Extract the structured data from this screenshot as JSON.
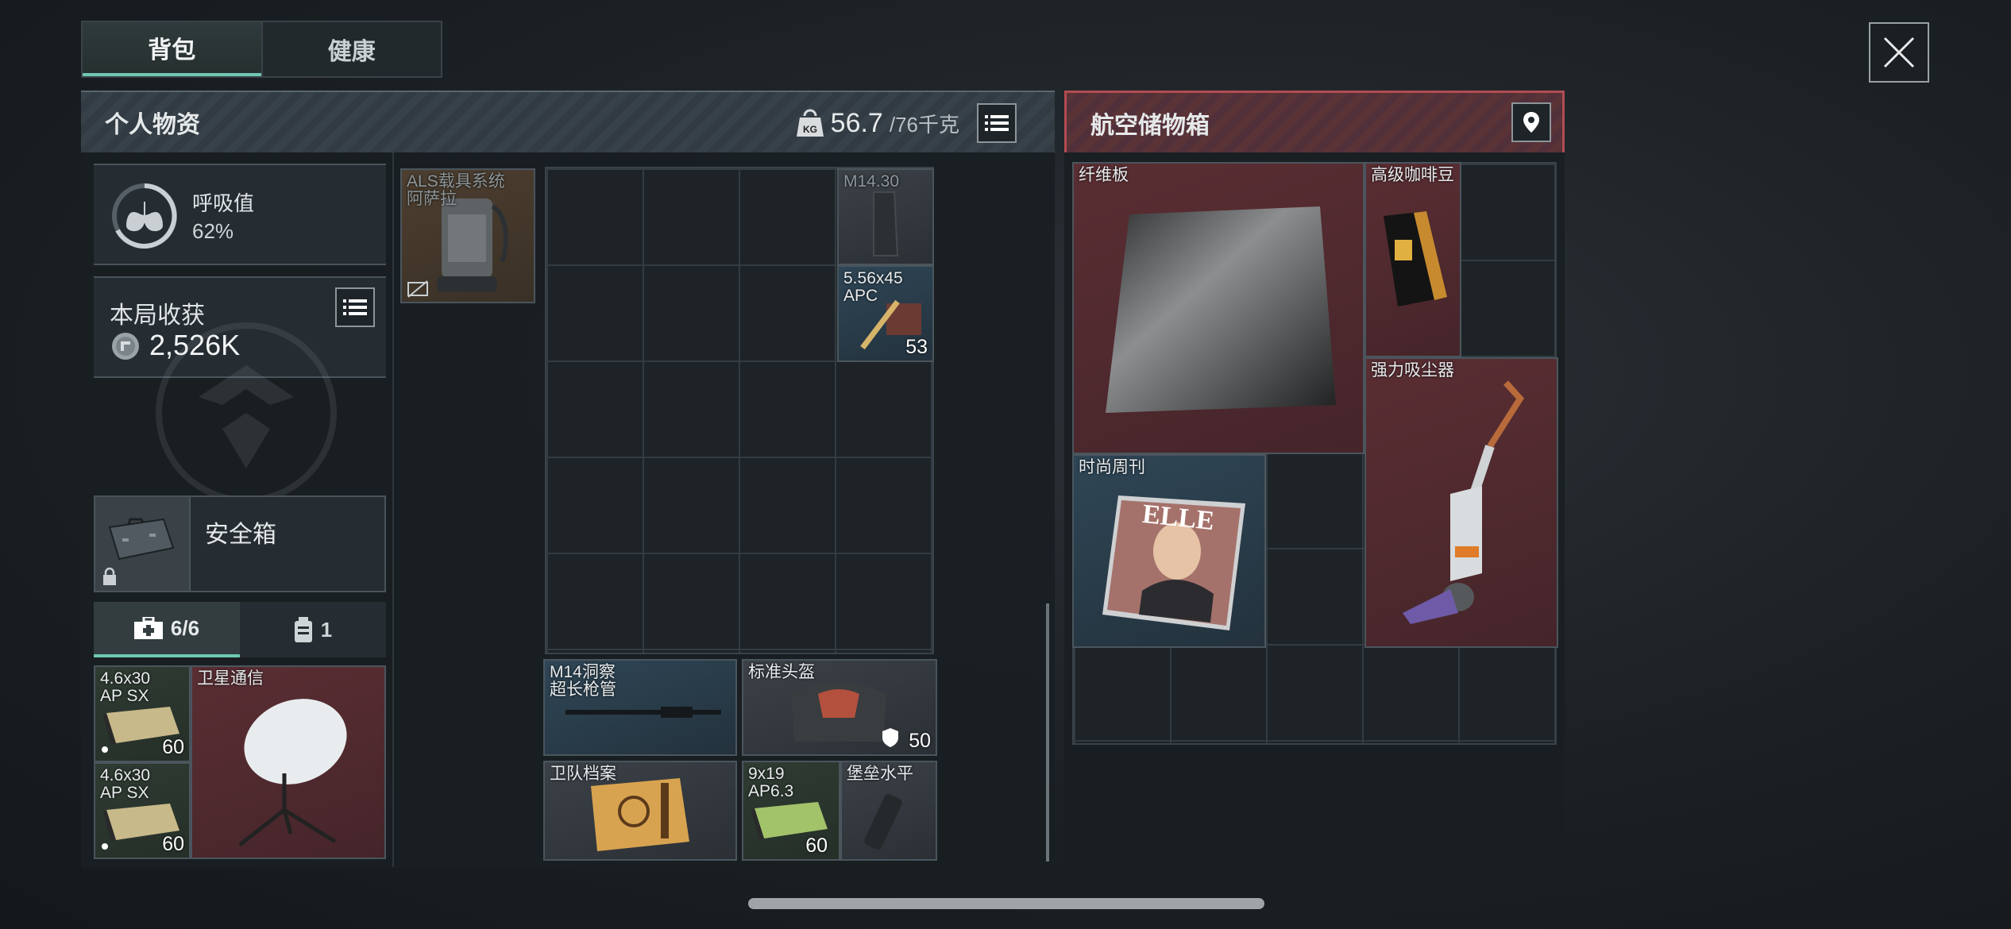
{
  "tabs": [
    {
      "label": "背包",
      "active": true
    },
    {
      "label": "健康",
      "active": false
    }
  ],
  "left_panel": {
    "title": "个人物资",
    "weight_current": "56.7",
    "weight_max": "/76千克",
    "icon_weight": "kg-weight-icon",
    "icon_list": "list-icon"
  },
  "right_panel": {
    "title": "航空储物箱",
    "icon_location": "location-pin-icon"
  },
  "breath": {
    "label": "呼吸值",
    "value": "62%"
  },
  "harvest": {
    "label": "本局收获",
    "value": "2,526K"
  },
  "safe_box": {
    "label": "安全箱"
  },
  "subtabs": [
    {
      "label": "6/6",
      "icon": "medkit-icon",
      "active": true
    },
    {
      "label": "1",
      "icon": "backpack-icon",
      "active": false
    }
  ],
  "left_items": [
    {
      "name": "4.6x30\nAP SX",
      "qty": "60"
    },
    {
      "name": "卫星通信",
      "qty": ""
    },
    {
      "name": "4.6x30\nAP SX",
      "qty": "60"
    }
  ],
  "backpack_items": [
    {
      "name": "ALS载具系统\n阿萨拉",
      "qty": ""
    },
    {
      "name": "M14.30",
      "qty": ""
    },
    {
      "name": "5.56x45\nAPC",
      "qty": "53"
    },
    {
      "name": "M14洞察\n超长枪管",
      "qty": ""
    },
    {
      "name": "标准头盔",
      "qty": "50"
    },
    {
      "name": "卫队档案",
      "qty": ""
    },
    {
      "name": "9x19\nAP6.3",
      "qty": "60"
    },
    {
      "name": "堡垒水平",
      "qty": ""
    }
  ],
  "storage_items": [
    {
      "name": "纤维板"
    },
    {
      "name": "高级咖啡豆"
    },
    {
      "name": "强力吸尘器"
    },
    {
      "name": "时尚周刊"
    }
  ],
  "colors": {
    "accent": "#6fc8b2",
    "danger": "#b24c52"
  }
}
